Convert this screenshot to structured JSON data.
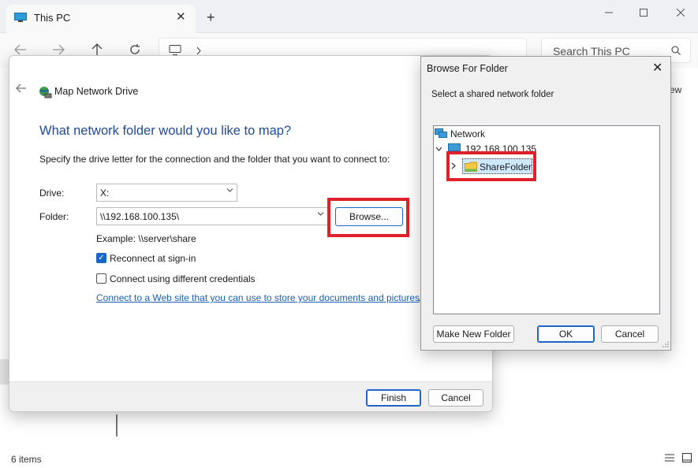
{
  "explorer": {
    "tab_title": "This PC",
    "tab_close": "✕",
    "new_tab": "+",
    "search_placeholder": "Search This PC",
    "status_items": "6 items",
    "partial_text": "ew"
  },
  "map_drive": {
    "title": "Map Network Drive",
    "heading": "What network folder would you like to map?",
    "description": "Specify the drive letter for the connection and the folder that you want to connect to:",
    "drive_label": "Drive:",
    "drive_value": "X:",
    "folder_label": "Folder:",
    "folder_value": "\\\\192.168.100.135\\",
    "browse_label": "Browse...",
    "example": "Example: \\\\server\\share",
    "reconnect_label": "Reconnect at sign-in",
    "reconnect_checked": true,
    "credentials_label": "Connect using different credentials",
    "credentials_checked": false,
    "link_text": "Connect to a Web site that you can use to store your documents and pictures",
    "link_suffix": ".",
    "finish_label": "Finish",
    "cancel_label": "Cancel"
  },
  "browse_folder": {
    "title": "Browse For Folder",
    "close_glyph": "✕",
    "subtitle": "Select a shared network folder",
    "tree": {
      "root": "Network",
      "host": "192.168.100.135",
      "share": "ShareFolder"
    },
    "make_new_folder_label": "Make New Folder",
    "ok_label": "OK",
    "cancel_label": "Cancel"
  },
  "colors": {
    "accent": "#1e66c8",
    "highlight_red": "#e0202a",
    "heading_blue": "#1e4a9c"
  }
}
